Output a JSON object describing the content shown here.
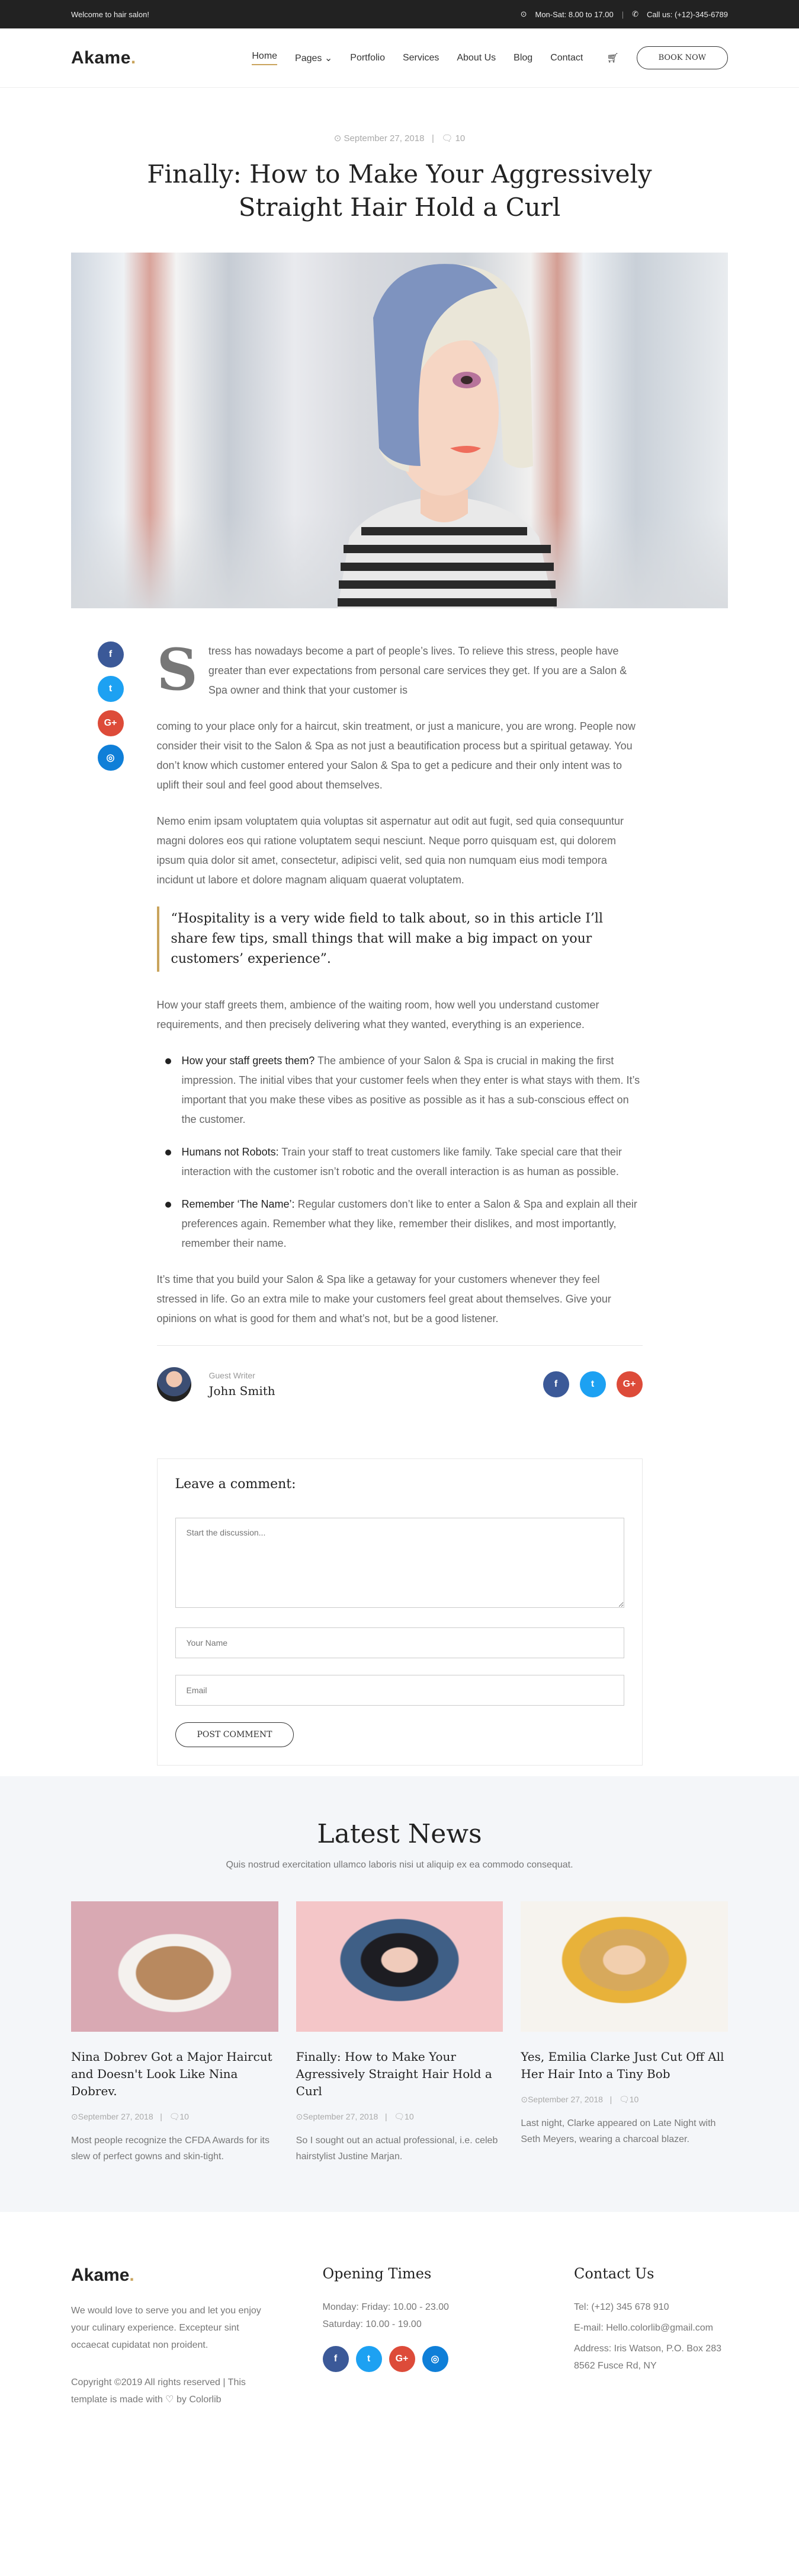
{
  "topbar": {
    "welcome": "Welcome to hair salon!",
    "hours": "Mon-Sat: 8.00 to 17.00",
    "phone": "Call us: (+12)-345-6789"
  },
  "header": {
    "logo": "Akame",
    "nav": [
      "Home",
      "Pages",
      "Portfolio",
      "Services",
      "About Us",
      "Blog",
      "Contact"
    ],
    "book": "BOOK NOW"
  },
  "post": {
    "date": "September 27, 2018",
    "comments": "10",
    "title": "Finally: How to Make Your Aggressively Straight Hair Hold a Curl",
    "dropcap": "S",
    "intro": "tress has nowadays become a part of people’s lives. To relieve this stress, people have greater than ever expectations from personal care services they get. If you are a Salon & Spa owner and think that your customer is",
    "p1": "coming to your place only for a haircut, skin treatment, or just a manicure, you are wrong. People now consider their visit to the Salon & Spa as not just a beautification process but a spiritual getaway. You don’t know which customer entered your Salon & Spa to get a pedicure and their only intent was to uplift their soul and feel good about themselves.",
    "p2": "Nemo enim ipsam voluptatem quia voluptas sit aspernatur aut odit aut fugit, sed quia consequuntur magni dolores eos qui ratione voluptatem sequi nesciunt. Neque porro quisquam est, qui dolorem ipsum quia dolor sit amet, consectetur, adipisci velit, sed quia non numquam eius modi tempora incidunt ut labore et dolore magnam aliquam quaerat voluptatem.",
    "quote": "“Hospitality is a very wide field to talk about, so in this article I’ll share few tips, small things that will make a big impact on your customers’ experience”.",
    "p3": "How your staff greets them, ambience of the waiting room, how well you understand customer requirements, and then precisely delivering what they wanted, everything is an experience.",
    "bullets": [
      {
        "title": "How your staff greets them?",
        "text": " The ambience of your Salon & Spa is crucial in making the first impression. The initial vibes that your customer feels when they enter is what stays with them. It’s important that you make these vibes as positive as possible as it has a sub-conscious effect on the customer."
      },
      {
        "title": "Humans not Robots:",
        "text": " Train your staff to treat customers like family. Take special care that their interaction with the customer isn’t robotic and the overall interaction is as human as possible."
      },
      {
        "title": "Remember ‘The Name’:",
        "text": " Regular customers don’t like to enter a Salon & Spa and explain all their preferences again. Remember what they like, remember their dislikes, and most importantly, remember their name."
      }
    ],
    "p4": "It’s time that you build your Salon & Spa like a getaway for your customers whenever they feel stressed in life. Go an extra mile to make your customers feel great about themselves. Give your opinions on what is good for them and what’s not, but be a good listener."
  },
  "author": {
    "role": "Guest Writer",
    "name": "John Smith"
  },
  "comment": {
    "title": "Leave a comment:",
    "message_placeholder": "Start the discussion...",
    "name_placeholder": "Your Name",
    "email_placeholder": "Email",
    "button": "POST COMMENT"
  },
  "news": {
    "title": "Latest News",
    "subtitle": "Quis nostrud exercitation ullamco laboris nisi ut aliquip ex ea commodo consequat.",
    "cards": [
      {
        "title": "Nina Dobrev Got a Major Haircut and Doesn't Look Like Nina Dobrev.",
        "date": "September 27, 2018",
        "comments": "10",
        "excerpt": "Most people recognize the CFDA Awards for its slew of perfect gowns and skin-tight."
      },
      {
        "title": "Finally: How to Make Your Agressively Straight Hair Hold a Curl",
        "date": "September 27, 2018",
        "comments": "10",
        "excerpt": "So I sought out an actual professional, i.e. celeb hairstylist Justine Marjan."
      },
      {
        "title": "Yes, Emilia Clarke Just Cut Off All Her Hair Into a Tiny Bob",
        "date": "September 27, 2018",
        "comments": "10",
        "excerpt": "Last night, Clarke appeared on Late Night with Seth Meyers, wearing a charcoal blazer."
      }
    ]
  },
  "footer": {
    "logo": "Akame",
    "about": "We would love to serve you and let you enjoy your culinary experience. Excepteur sint occaecat cupidatat non proident.",
    "copyright": "Copyright ©2019 All rights reserved | This template is made with ♡ by Colorlib",
    "hours_title": "Opening Times",
    "hours": [
      "Monday: Friday: 10.00 - 23.00",
      "Saturday: 10.00 - 19.00"
    ],
    "contact_title": "Contact Us",
    "tel": "Tel: (+12) 345 678 910",
    "email": "E-mail: Hello.colorlib@gmail.com",
    "address": "Address: Iris Watson, P.O. Box 283 8562 Fusce Rd, NY"
  },
  "colors": {
    "accent": "#c9a45c",
    "facebook": "#3b5998",
    "twitter": "#1da1f2",
    "google": "#dd4b39",
    "instagram": "#0f7fd8"
  },
  "icons": [
    "clock-icon",
    "phone-icon",
    "calendar-icon",
    "comment-icon",
    "cart-icon",
    "facebook-icon",
    "twitter-icon",
    "google-plus-icon",
    "instagram-icon"
  ]
}
